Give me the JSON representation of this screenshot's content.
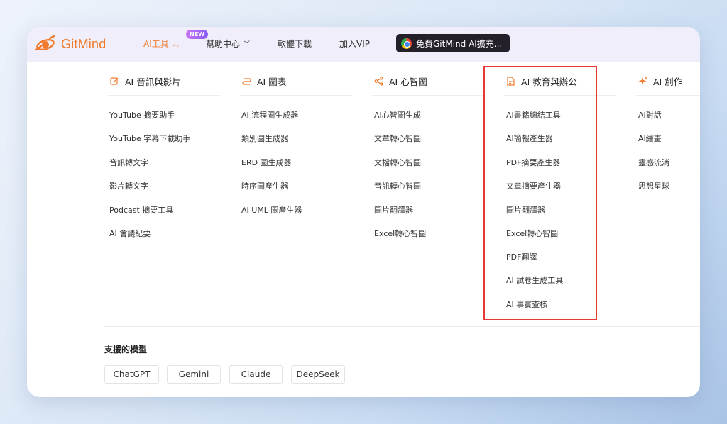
{
  "brand": {
    "name": "GitMind",
    "color": "#f07b2c"
  },
  "nav": {
    "ai_tools": "AI工具",
    "new_badge": "NEW",
    "help_center": "幫助中心",
    "download": "軟體下載",
    "vip": "加入VIP",
    "chrome_cta": "免費GitMind AI擴充..."
  },
  "columns": [
    {
      "title": "AI 音訊與影片",
      "icon": "video-edit-icon",
      "items": [
        "YouTube 摘要助手",
        "YouTube 字幕下載助手",
        "音訊轉文字",
        "影片轉文字",
        "Podcast 摘要工具",
        "AI 會議紀要"
      ]
    },
    {
      "title": "AI 圖表",
      "icon": "chart-flow-icon",
      "items": [
        "AI 流程圖生成器",
        "類別圖生成器",
        "ERD 圖生成器",
        "時序圖產生器",
        "AI UML 圖產生器"
      ]
    },
    {
      "title": "AI 心智圖",
      "icon": "mindmap-icon",
      "items": [
        "AI心智圖生成",
        "文章轉心智圖",
        "文檔轉心智圖",
        "音訊轉心智圖",
        "圖片翻譯器",
        "Excel轉心智圖"
      ]
    },
    {
      "title": "AI 教育與辦公",
      "icon": "document-office-icon",
      "items": [
        "AI書籍總結工具",
        "AI簡報產生器",
        "PDF摘要產生器",
        "文章摘要產生器",
        "圖片翻譯器",
        "Excel轉心智圖",
        "PDF翻譯",
        "AI 試卷生成工具",
        "AI 事實查核"
      ]
    },
    {
      "title": "AI 創作",
      "icon": "sparkle-icon",
      "items": [
        "AI對話",
        "AI繪畫",
        "靈感流淌",
        "思想星球"
      ]
    }
  ],
  "support": {
    "title": "支援的模型",
    "models": [
      "ChatGPT",
      "Gemini",
      "Claude",
      "DeepSeek"
    ]
  },
  "colors": {
    "highlight": "#e53935",
    "accent": "#f07b2c",
    "topbar": "#f1eefb"
  }
}
